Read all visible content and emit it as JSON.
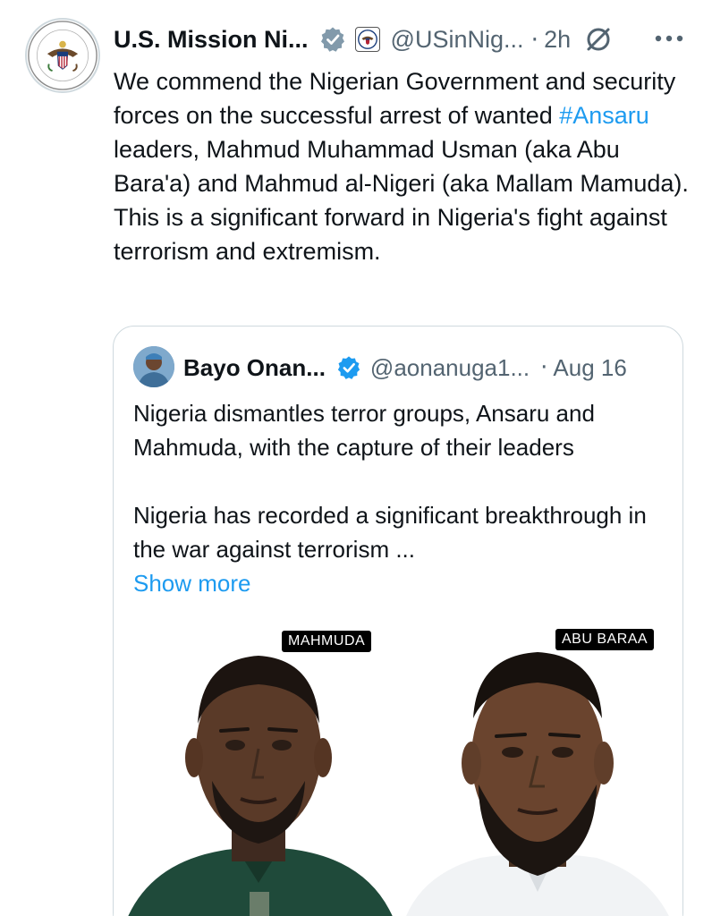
{
  "tweet": {
    "display_name": "U.S. Mission Ni...",
    "handle": "@USinNig...",
    "separator": "·",
    "time": "2h",
    "text_before_hashtag": "We commend the Nigerian Government and security forces on the successful arrest of wanted ",
    "hashtag": "#Ansaru",
    "text_after_hashtag": " leaders, Mahmud Muhammad Usman (aka Abu Bara'a) and Mahmud al-Nigeri (aka Mallam Mamuda). This is a significant forward in Nigeria's fight against terrorism and extremism.",
    "avatar_icon": "us-mission-seal-icon",
    "verified_icon": "verified-badge-icon",
    "gov_icon": "government-affiliation-icon",
    "grok_icon": "grok-icon",
    "more_icon": "more-options-icon"
  },
  "quote": {
    "display_name": "Bayo Onan...",
    "handle": "@aonanuga1...",
    "separator": "·",
    "date": "Aug 16",
    "paragraph1": "Nigeria dismantles terror groups, Ansaru and Mahmuda, with the capture of their leaders",
    "paragraph2": "Nigeria has recorded a significant breakthrough in the war against terrorism ...",
    "show_more": "Show more",
    "media": {
      "label_left": "MAHMUDA",
      "label_right": "ABU BARAA"
    }
  },
  "colors": {
    "text": "#0f1419",
    "secondary": "#536471",
    "link": "#1d9bf0",
    "border": "#cfd9de"
  }
}
